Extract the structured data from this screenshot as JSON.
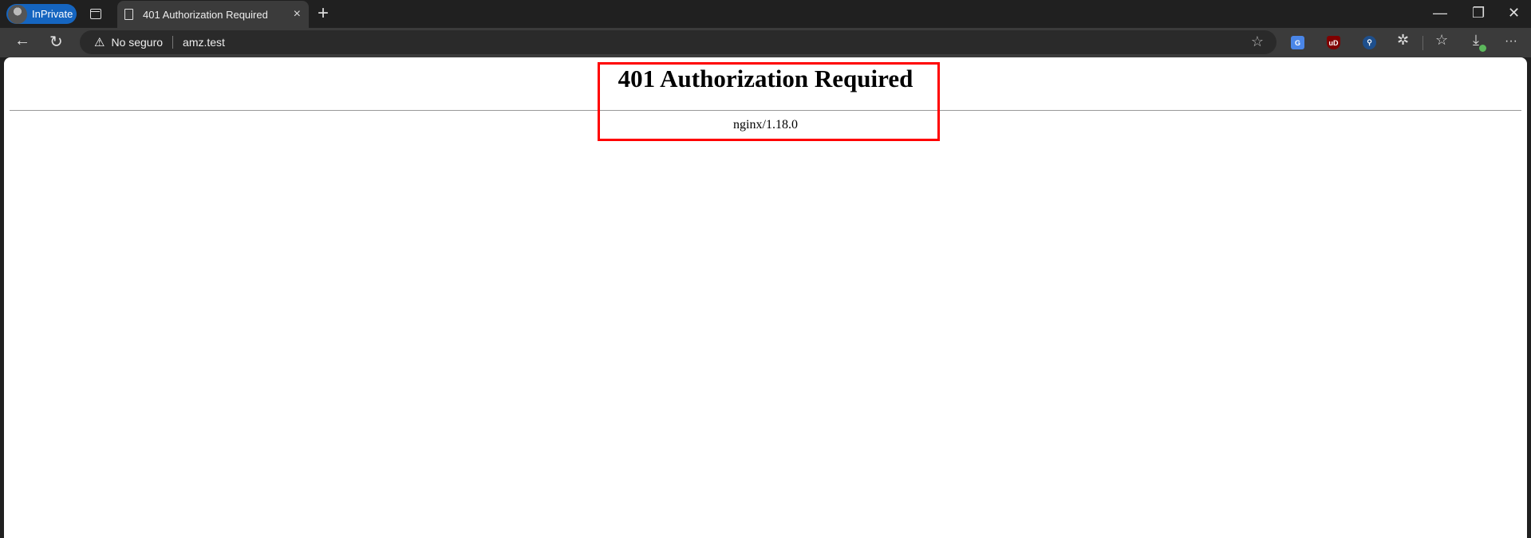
{
  "browser": {
    "profile_label": "InPrivate",
    "tab": {
      "title": "401 Authorization Required",
      "close": "×"
    },
    "new_tab": "+",
    "window": {
      "minimize": "—",
      "restore": "❐",
      "close": "✕"
    },
    "nav": {
      "back": "←",
      "reload": "↻"
    },
    "address": {
      "security_label": "No seguro",
      "url": "amz.test",
      "warning": "⚠",
      "favorite": "☆"
    },
    "extensions": [
      {
        "name": "google-translate",
        "label": "G",
        "color": "#4a86e8"
      },
      {
        "name": "ublock-origin",
        "label": "uD",
        "color": "#800000"
      },
      {
        "name": "privacy-heart",
        "label": "⚲",
        "color": "#1e4f8c"
      }
    ],
    "toolbar_icons": {
      "extensions": "✲",
      "favorites": "☆",
      "downloads": "⤓",
      "more": "···"
    }
  },
  "page": {
    "heading": "401 Authorization Required",
    "server": "nginx/1.18.0"
  }
}
